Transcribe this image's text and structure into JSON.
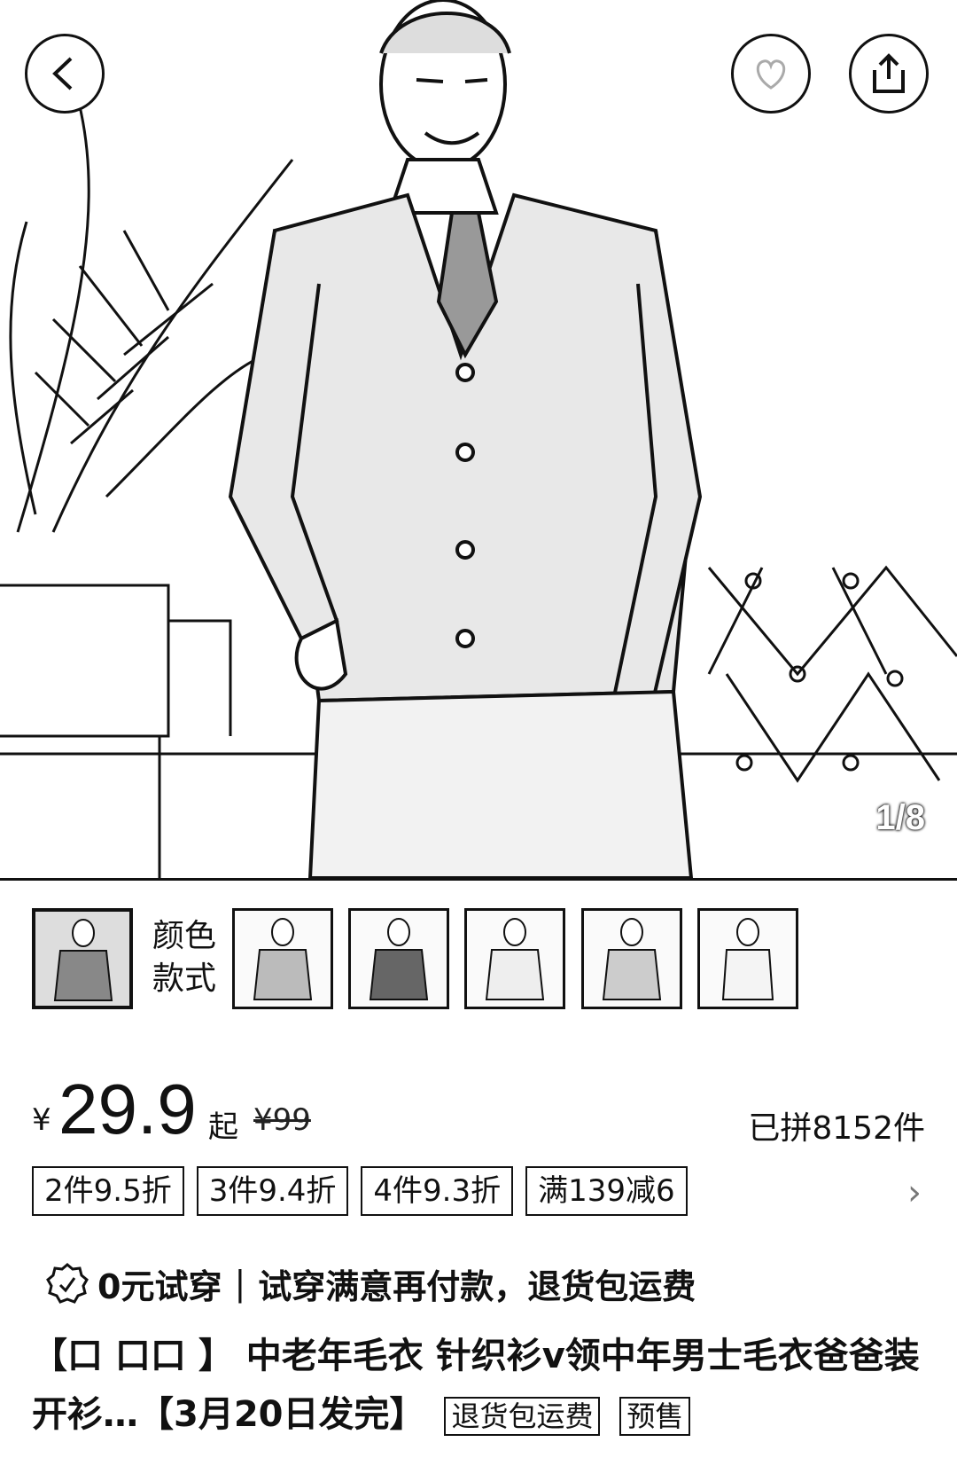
{
  "gallery": {
    "counter": "1/8",
    "style_label_line1": "颜色",
    "style_label_line2": "款式"
  },
  "price": {
    "currency": "¥",
    "value": "29.9",
    "suffix": "起",
    "original": "¥99",
    "sold": "已拼8152件"
  },
  "promo_tags": [
    "2件9.5折",
    "3件9.4折",
    "4件9.3折",
    "满139减6"
  ],
  "trial": {
    "label": "0元试穿",
    "separator": "|",
    "text": "试穿满意再付款，退货包运费"
  },
  "product": {
    "title_prefix": "【口    口口    】",
    "title": "中老年毛衣 针织衫v领中年男士毛衣爸爸装开衫…【3月20日发完】",
    "badge_return": "退货包运费",
    "badge_presale": "预售"
  },
  "icons": {
    "back": "chevron-left-icon",
    "favorite": "heart-icon",
    "share": "share-icon",
    "trial": "shield-badge-icon"
  }
}
